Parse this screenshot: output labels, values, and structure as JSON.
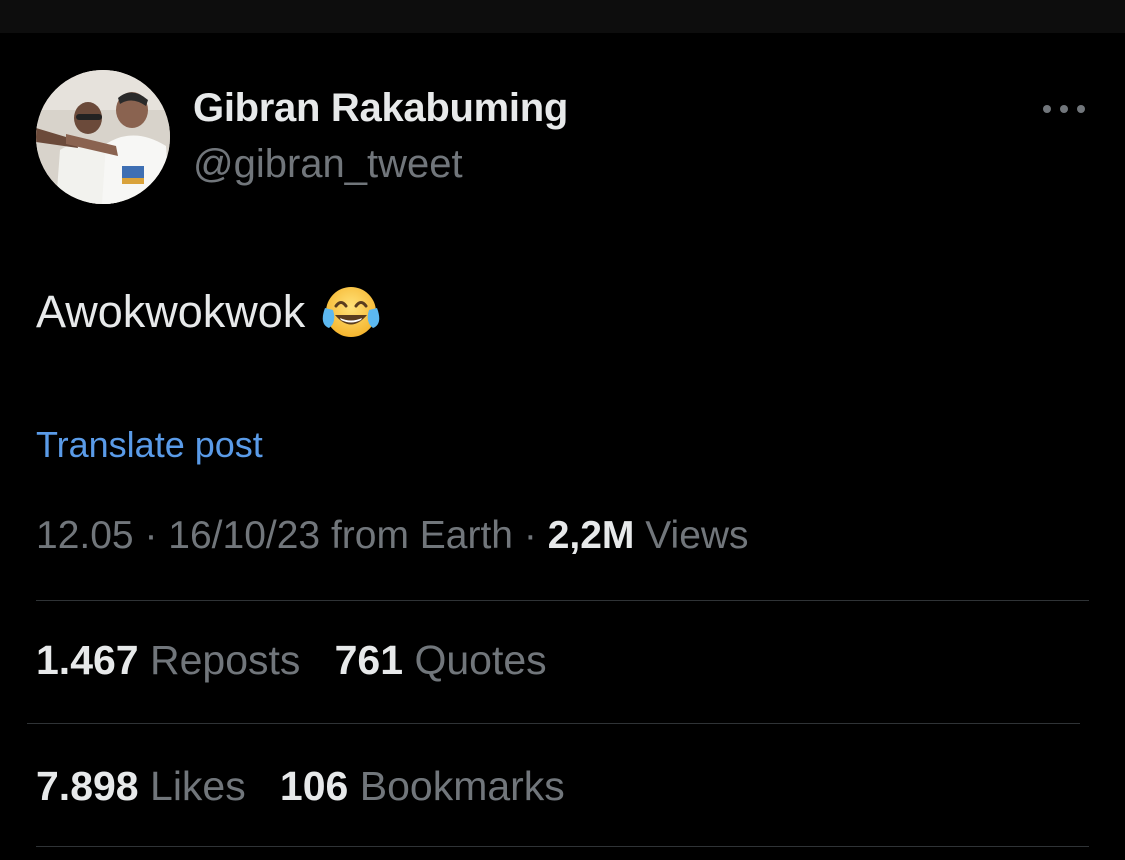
{
  "author": {
    "display_name": "Gibran Rakabuming",
    "handle": "@gibran_tweet",
    "avatar_icon": "profile-photo"
  },
  "more_icon": "ellipsis-horizontal-icon",
  "post": {
    "text": "Awokwokwok",
    "emoji_icon": "face-with-tears-of-joy-emoji"
  },
  "translate_label": "Translate post",
  "meta": {
    "time": "12.05",
    "separator": "·",
    "date_source": "16/10/23 from Earth",
    "views_count": "2,2M",
    "views_label": "Views"
  },
  "stats": {
    "reposts_count": "1.467",
    "reposts_label": "Reposts",
    "quotes_count": "761",
    "quotes_label": "Quotes",
    "likes_count": "7.898",
    "likes_label": "Likes",
    "bookmarks_count": "106",
    "bookmarks_label": "Bookmarks"
  },
  "colors": {
    "background": "#000000",
    "primary_text": "#e7e9ea",
    "secondary_text": "#71767b",
    "link": "#5a9be8",
    "divider": "#2f3336"
  }
}
